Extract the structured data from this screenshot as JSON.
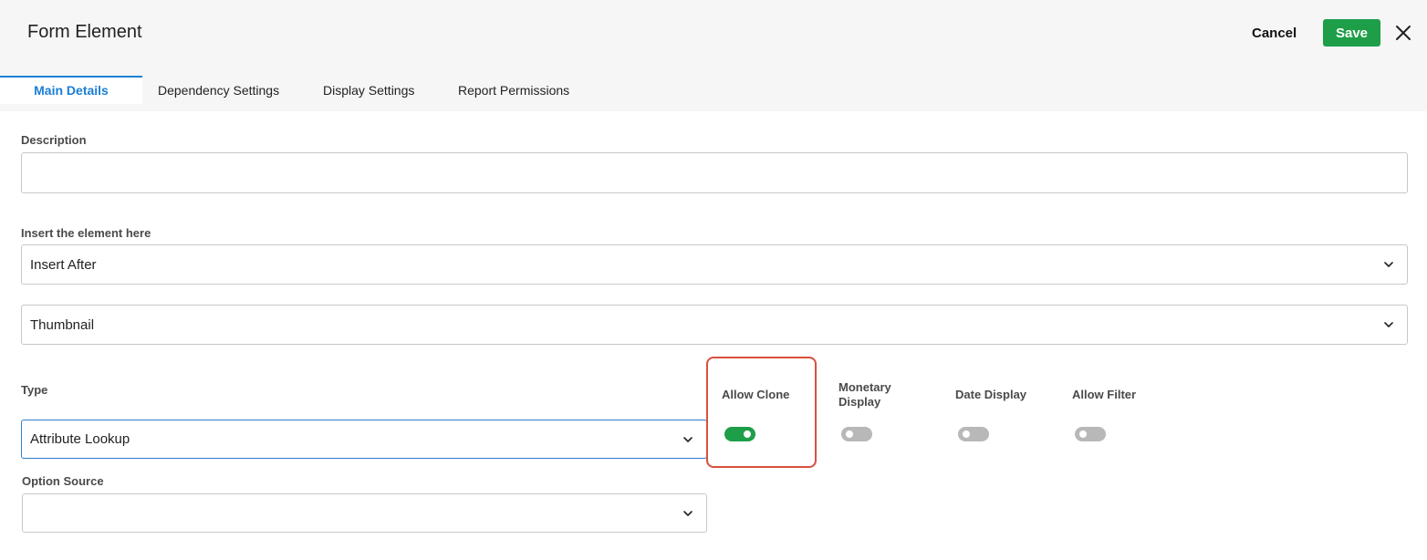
{
  "header": {
    "title": "Form Element",
    "cancel_label": "Cancel",
    "save_label": "Save"
  },
  "tabs": [
    {
      "label": "Main Details",
      "active": true
    },
    {
      "label": "Dependency Settings",
      "active": false
    },
    {
      "label": "Display Settings",
      "active": false
    },
    {
      "label": "Report Permissions",
      "active": false
    }
  ],
  "form": {
    "description": {
      "label": "Description",
      "value": ""
    },
    "insert": {
      "label": "Insert the element here",
      "value": "Insert After"
    },
    "reference": {
      "value": "Thumbnail"
    },
    "type": {
      "label": "Type",
      "value": "Attribute Lookup"
    },
    "option_source": {
      "label": "Option Source",
      "value": ""
    }
  },
  "toggles": {
    "allow_clone": {
      "label": "Allow Clone",
      "on": true
    },
    "monetary_display": {
      "label_line1": "Monetary",
      "label_line2": "Display",
      "on": false
    },
    "date_display": {
      "label": "Date Display",
      "on": false
    },
    "allow_filter": {
      "label": "Allow Filter",
      "on": false
    }
  },
  "colors": {
    "accent_blue": "#1a7fd6",
    "save_green": "#1e9e48",
    "toggle_on": "#1e9e48",
    "toggle_off": "#b8b8b8",
    "highlight_red": "#d9503f"
  },
  "icons": {
    "close": "close-icon",
    "dropdown": "chevron-down-icon"
  }
}
